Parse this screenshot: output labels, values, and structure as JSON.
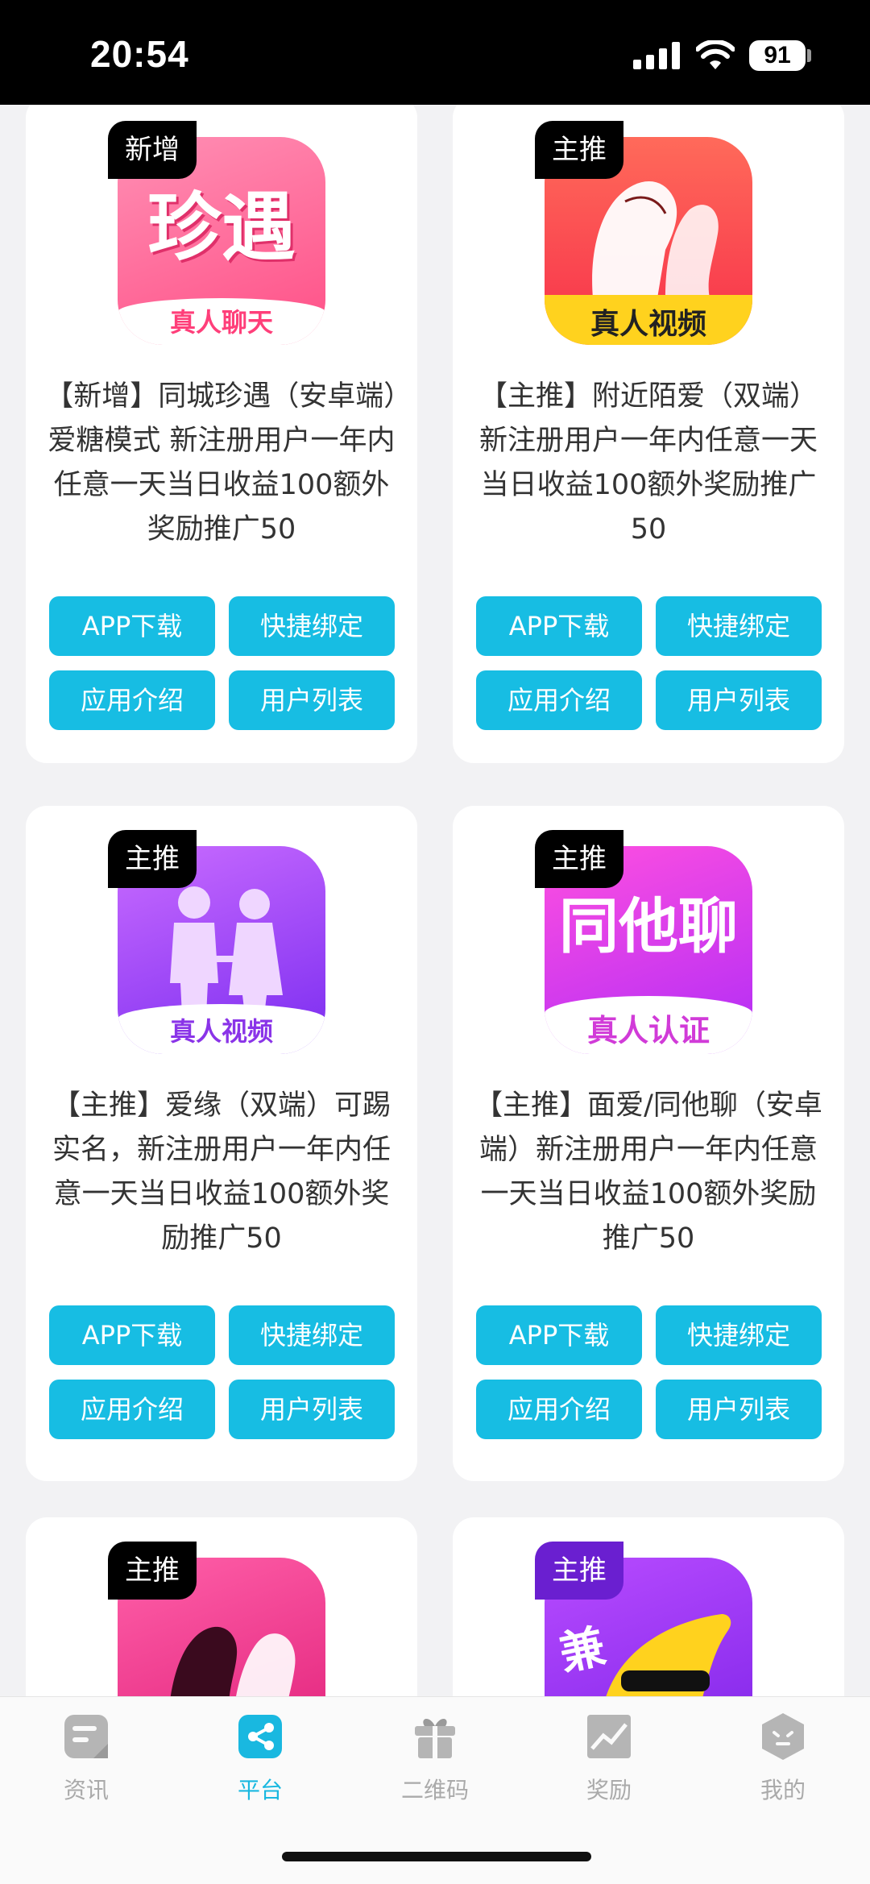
{
  "status": {
    "time": "20:54",
    "battery": "91"
  },
  "buttons": {
    "download": "APP下载",
    "bind": "快捷绑定",
    "intro": "应用介绍",
    "users": "用户列表"
  },
  "cards": [
    {
      "tag": "新增",
      "icon_top": "珍遇",
      "icon_bottom": "真人聊天",
      "desc": "【新增】同城珍遇（安卓端）爱糖模式 新注册用户一年内任意一天当日收益100额外奖励推广50"
    },
    {
      "tag": "主推",
      "icon_bottom": "真人视频",
      "desc": "【主推】附近陌爱（双端） 新注册用户一年内任意一天当日收益100额外奖励推广50"
    },
    {
      "tag": "主推",
      "icon_bottom": "真人视频",
      "desc": "【主推】爱缘（双端）可踢实名，新注册用户一年内任意一天当日收益100额外奖励推广50"
    },
    {
      "tag": "主推",
      "icon_top": "同他聊",
      "icon_bottom": "真人认证",
      "desc": "【主推】面爱/同他聊（安卓端）新注册用户一年内任意一天当日收益100额外奖励推广50"
    },
    {
      "tag": "主推"
    },
    {
      "tag": "主推",
      "icon_top": "兼"
    }
  ],
  "tabs": [
    {
      "label": "资讯",
      "icon": "news-icon"
    },
    {
      "label": "平台",
      "icon": "share-icon",
      "active": true
    },
    {
      "label": "二维码",
      "icon": "gift-icon"
    },
    {
      "label": "奖励",
      "icon": "chart-icon"
    },
    {
      "label": "我的",
      "icon": "profile-icon"
    }
  ],
  "colors": {
    "accent": "#17bde3",
    "tab_active": "#19b8e0",
    "tab_inactive": "#aaaaaa"
  }
}
